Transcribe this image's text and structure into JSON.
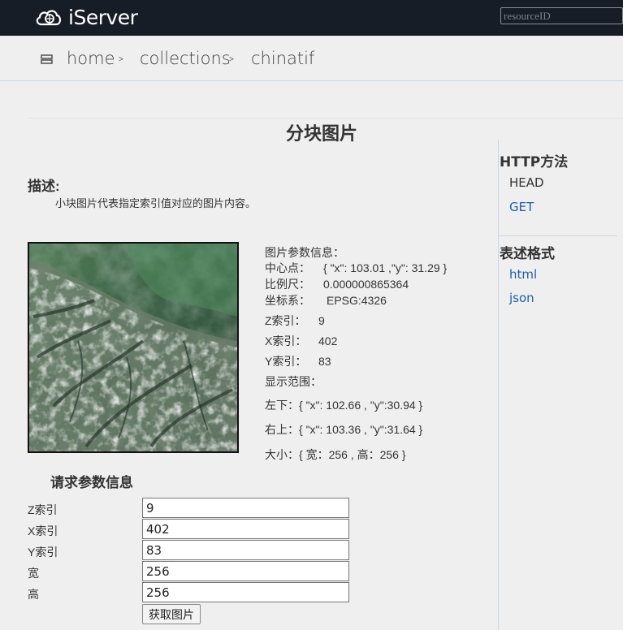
{
  "header": {
    "brand": "iServer",
    "search_placeholder": "resourceID"
  },
  "breadcrumb": {
    "items": [
      "home",
      "collections",
      "chinatif"
    ],
    "separator": ">"
  },
  "page": {
    "title": "分块图片",
    "description_heading": "描述:",
    "description": "小块图片代表指定索引值对应的图片内容。"
  },
  "sidebar": {
    "http_heading": "HTTP方法",
    "methods": [
      "HEAD",
      "GET"
    ],
    "format_heading": "表述格式",
    "formats": [
      "html",
      "json"
    ]
  },
  "info": {
    "heading": "图片参数信息：",
    "center_label": "中心点：",
    "center_value": "{ \"x\": 103.01 ,\"y\": 31.29 }",
    "scale_label": "比例尺：",
    "scale_value": "0.000000865364",
    "crs_label": "坐标系：",
    "crs_value": "EPSG:4326",
    "z_label": "Z索引：",
    "z_value": "9",
    "x_label": "X索引：",
    "x_value": "402",
    "y_label": "Y索引：",
    "y_value": "83",
    "extent_label": "显示范围：",
    "lower_left": "左下：{ \"x\": 102.66 , \"y\":30.94 }",
    "upper_right": "右上：{ \"x\": 103.36 , \"y\":31.64 }",
    "size": "大小：{ 宽：256 , 高：256 }"
  },
  "form": {
    "heading": "请求参数信息",
    "fields": [
      {
        "label": "Z索引",
        "value": "9"
      },
      {
        "label": "X索引",
        "value": "402"
      },
      {
        "label": "Y索引",
        "value": "83"
      },
      {
        "label": "宽",
        "value": "256"
      },
      {
        "label": "高",
        "value": "256"
      }
    ],
    "submit_label": "获取图片"
  },
  "colors": {
    "topbar": "#161d27",
    "link": "#1f5dae",
    "background": "#efefef"
  }
}
